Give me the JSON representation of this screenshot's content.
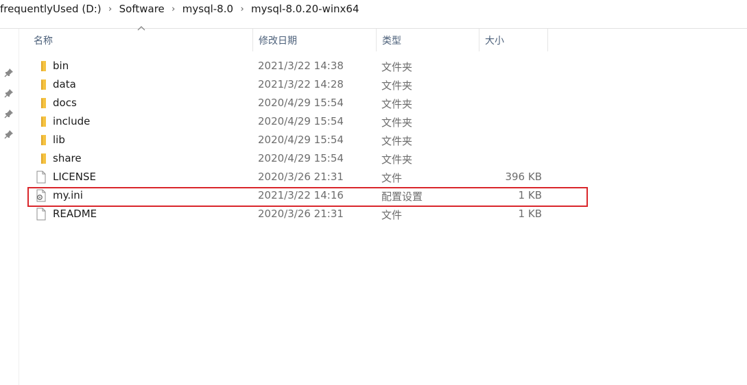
{
  "breadcrumb": [
    "frequentlyUsed (D:)",
    "Software",
    "mysql-8.0",
    "mysql-8.0.20-winx64"
  ],
  "columns": {
    "name": "名称",
    "date_modified": "修改日期",
    "type": "类型",
    "size": "大小"
  },
  "sort": {
    "column": "name",
    "direction": "ascending"
  },
  "files": [
    {
      "name": "bin",
      "date": "2021/3/22 14:38",
      "type": "文件夹",
      "size": "",
      "icon": "folder-icon"
    },
    {
      "name": "data",
      "date": "2021/3/22 14:28",
      "type": "文件夹",
      "size": "",
      "icon": "folder-icon"
    },
    {
      "name": "docs",
      "date": "2020/4/29 15:54",
      "type": "文件夹",
      "size": "",
      "icon": "folder-icon"
    },
    {
      "name": "include",
      "date": "2020/4/29 15:54",
      "type": "文件夹",
      "size": "",
      "icon": "folder-icon"
    },
    {
      "name": "lib",
      "date": "2020/4/29 15:54",
      "type": "文件夹",
      "size": "",
      "icon": "folder-icon"
    },
    {
      "name": "share",
      "date": "2020/4/29 15:54",
      "type": "文件夹",
      "size": "",
      "icon": "folder-icon"
    },
    {
      "name": "LICENSE",
      "date": "2020/3/26 21:31",
      "type": "文件",
      "size": "396 KB",
      "icon": "file-icon"
    },
    {
      "name": "my.ini",
      "date": "2021/3/22 14:16",
      "type": "配置设置",
      "size": "1 KB",
      "icon": "config-file-icon"
    },
    {
      "name": "README",
      "date": "2020/3/26 21:31",
      "type": "文件",
      "size": "1 KB",
      "icon": "file-icon"
    }
  ],
  "highlighted_file": "my.ini",
  "colors": {
    "folder": "#f5c342",
    "highlight_border": "#d9252a",
    "header_text": "#4c607a",
    "meta_text": "#6d6d6d"
  }
}
